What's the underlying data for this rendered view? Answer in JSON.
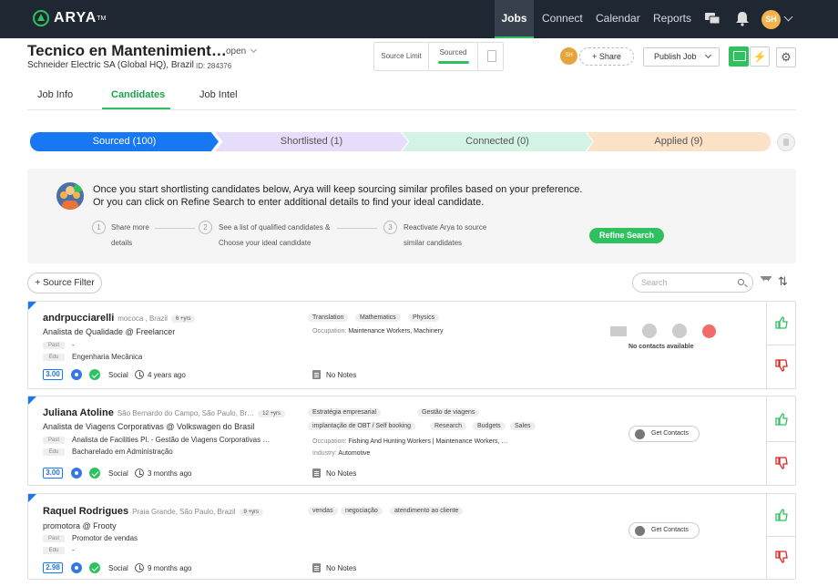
{
  "nav": {
    "brand": "ARYA",
    "items": [
      "Jobs",
      "Connect",
      "Calendar",
      "Reports"
    ],
    "avatar_initials": "SH",
    "colors": {
      "bg": "#1f2733",
      "accent": "#2fc15f"
    }
  },
  "job": {
    "title": "Tecnico en Mantenimient…",
    "status": "open",
    "company": "Schneider Electric SA (Global HQ), Brazil",
    "id_label": "ID: 284376",
    "source_limit_label": "Source Limit",
    "sourced_label": "Sourced",
    "owner_initials": "SH",
    "share_label": "Share",
    "publish_label": "Publish Job"
  },
  "tabs": [
    "Job Info",
    "Candidates",
    "Job Intel"
  ],
  "pipeline": {
    "sourced": "Sourced (100)",
    "shortlisted": "Shortlisted (1)",
    "connected": "Connected (0)",
    "applied": "Applied (9)"
  },
  "info": {
    "line1": "Once you start shortlisting candidates below, Arya will keep sourcing similar profiles based on your preference.",
    "line2": "Or you can click on Refine Search to enter additional details to find your ideal candidate.",
    "steps": [
      {
        "num": "1",
        "a": "Share more",
        "b": "details"
      },
      {
        "num": "2",
        "a": "See a list of qualified candidates &",
        "b": "Choose your ideal candidate"
      },
      {
        "num": "3",
        "a": "Reactivate Arya to source",
        "b": "similar candidates"
      }
    ],
    "refine_label": "Refine Search"
  },
  "filters": {
    "source_filter_label": "+ Source Filter",
    "search_placeholder": "Search"
  },
  "candidates": [
    {
      "name": "andrpucciarelli",
      "location": "mococa , Brazil",
      "years": "6 +yrs",
      "title": "Analista de Qualidade @ Freelancer",
      "past_label": "Past",
      "past_value": "-",
      "edu_label": "Edu",
      "edu_value": "Engenharia Mecânica",
      "score": "3.00",
      "social_label": "Social",
      "ago": "4 years ago",
      "tags": [
        "Translation",
        "Mathematics",
        "Physics"
      ],
      "occupation_label": "Occupation:",
      "occupation": "Maintenance Workers, Machinery",
      "notes": "No Notes",
      "contacts": "No contacts available"
    },
    {
      "name": "Juliana Atoline",
      "location": "São Bernardo do Campo, São Paulo, Br…",
      "years": "12 +yrs",
      "title": "Analista de Viagens Corporativas @ Volkswagen do Brasil",
      "past_label": "Past",
      "past_value": "Analista de Facilities Pl. - Gestão de Viagens Corporativas …",
      "edu_label": "Edu",
      "edu_value": "Bacharelado em Administração",
      "score": "3.00",
      "social_label": "Social",
      "ago": "3 months ago",
      "tags": [
        "Estratégia empresarial",
        "Gestão de viagens",
        "implantação de OBT / Self booking",
        "Research",
        "Budgets",
        "Sales"
      ],
      "occupation_label": "Occupation:",
      "occupation": "Fishing And Hunting Workers | Maintenance Workers, …",
      "industry_label": "Industry:",
      "industry": "Automotive",
      "notes": "No Notes",
      "contacts": "Get Contacts"
    },
    {
      "name": "Raquel Rodrigues",
      "location": "Praia Grande, São Paulo, Brazil",
      "years": "9 +yrs",
      "title": "promotora @ Frooty",
      "past_label": "Past",
      "past_value": "Promotor de vendas",
      "edu_label": "Edu",
      "edu_value": "-",
      "score": "2.98",
      "social_label": "Social",
      "ago": "9 months ago",
      "tags": [
        "vendas",
        "negociação",
        "atendimento ao cliente"
      ],
      "notes": "No Notes",
      "contacts": "Get Contacts"
    }
  ]
}
